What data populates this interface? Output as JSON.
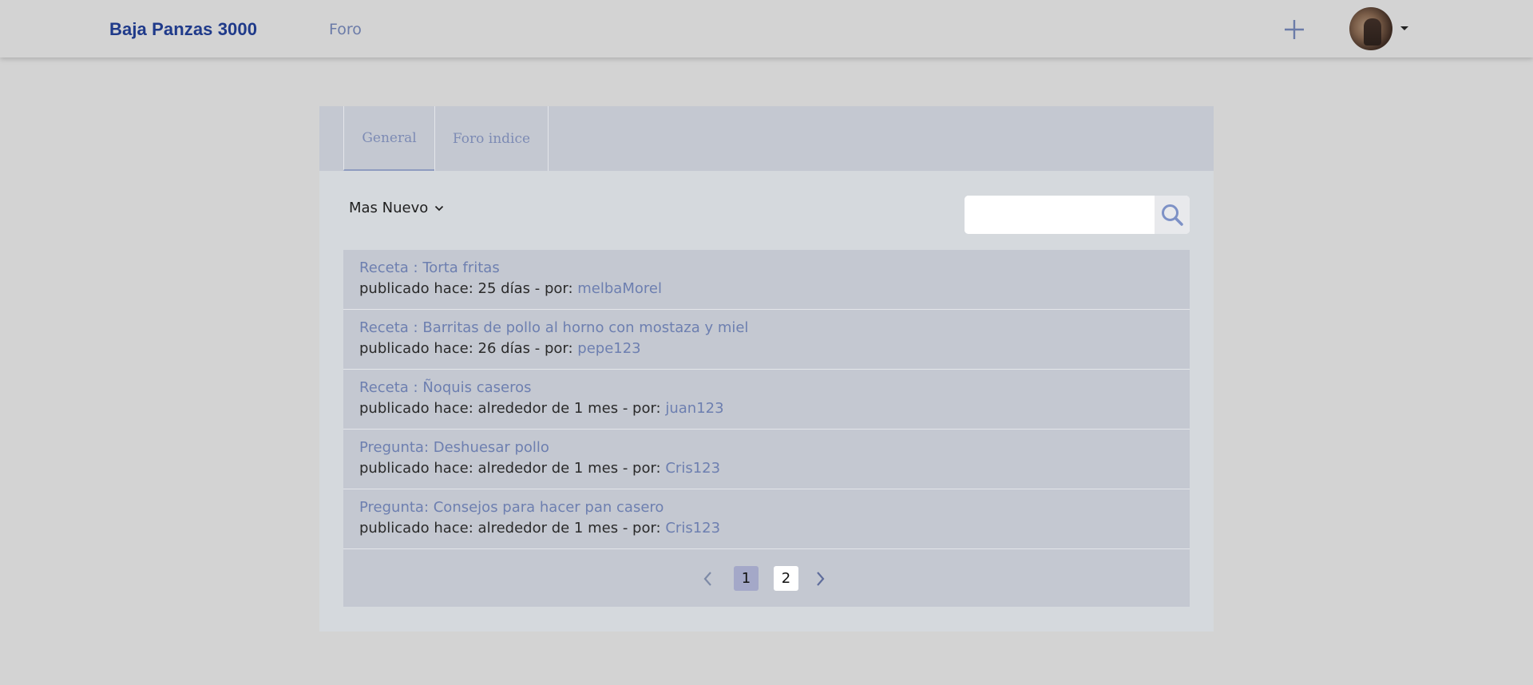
{
  "navbar": {
    "brand": "Baja Panzas 3000",
    "forum_link": "Foro",
    "add_icon": "plus-icon",
    "avatar_icon": "user-avatar",
    "menu_icon": "caret-down-icon"
  },
  "tabs": [
    {
      "label": "General",
      "active": true
    },
    {
      "label": "Foro indice",
      "active": false
    }
  ],
  "sort": {
    "label": "Mas Nuevo",
    "icon": "chevron-down-icon"
  },
  "search": {
    "placeholder": "",
    "value": "",
    "icon": "search-icon"
  },
  "posts": [
    {
      "title": "Receta : Torta fritas",
      "meta": "publicado hace: 25 días - por: ",
      "author": "melbaMorel"
    },
    {
      "title": "Receta : Barritas de pollo al horno con mostaza y miel",
      "meta": "publicado hace: 26 días - por: ",
      "author": "pepe123"
    },
    {
      "title": "Receta : Ñoquis caseros",
      "meta": "publicado hace: alrededor de 1 mes - por: ",
      "author": "juan123"
    },
    {
      "title": "Pregunta: Deshuesar pollo",
      "meta": "publicado hace: alrededor de 1 mes - por: ",
      "author": "Cris123"
    },
    {
      "title": "Pregunta: Consejos para hacer pan casero",
      "meta": "publicado hace: alrededor de 1 mes - por: ",
      "author": "Cris123"
    }
  ],
  "pagination": {
    "pages": [
      "1",
      "2"
    ],
    "current": "1",
    "prev_icon": "chevron-left-icon",
    "next_icon": "chevron-right-icon"
  },
  "colors": {
    "background": "#d3d3d3",
    "brand": "#1f3a8a",
    "link": "#6d7fb0",
    "panel": "#c4c8d1",
    "active_page": "#a4a8c8"
  }
}
